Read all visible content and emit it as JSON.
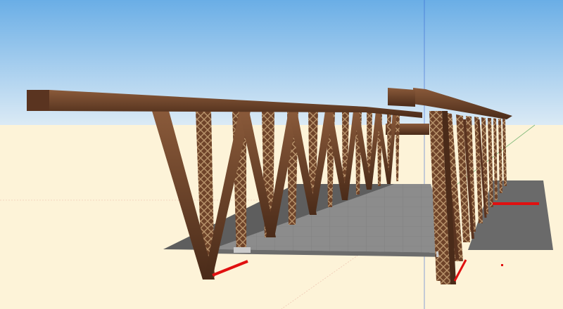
{
  "colors": {
    "sky_top": "#6aaee6",
    "sky_bottom": "#d9eaf7",
    "ground": "#fdf3d8",
    "truss": "#6e4329",
    "truss_dark": "#4a2b19",
    "truss_light": "#8a5a3a",
    "deck": "#8a8a8a",
    "deck_shadow": "#6f6f6f",
    "highlight_edge": "#e01010",
    "axis_blue": "#3060d0",
    "axis_green": "#4aa050",
    "axis_red": "#c85050"
  },
  "scene": {
    "subject": "steel-truss-bridge-model",
    "view": "perspective"
  }
}
